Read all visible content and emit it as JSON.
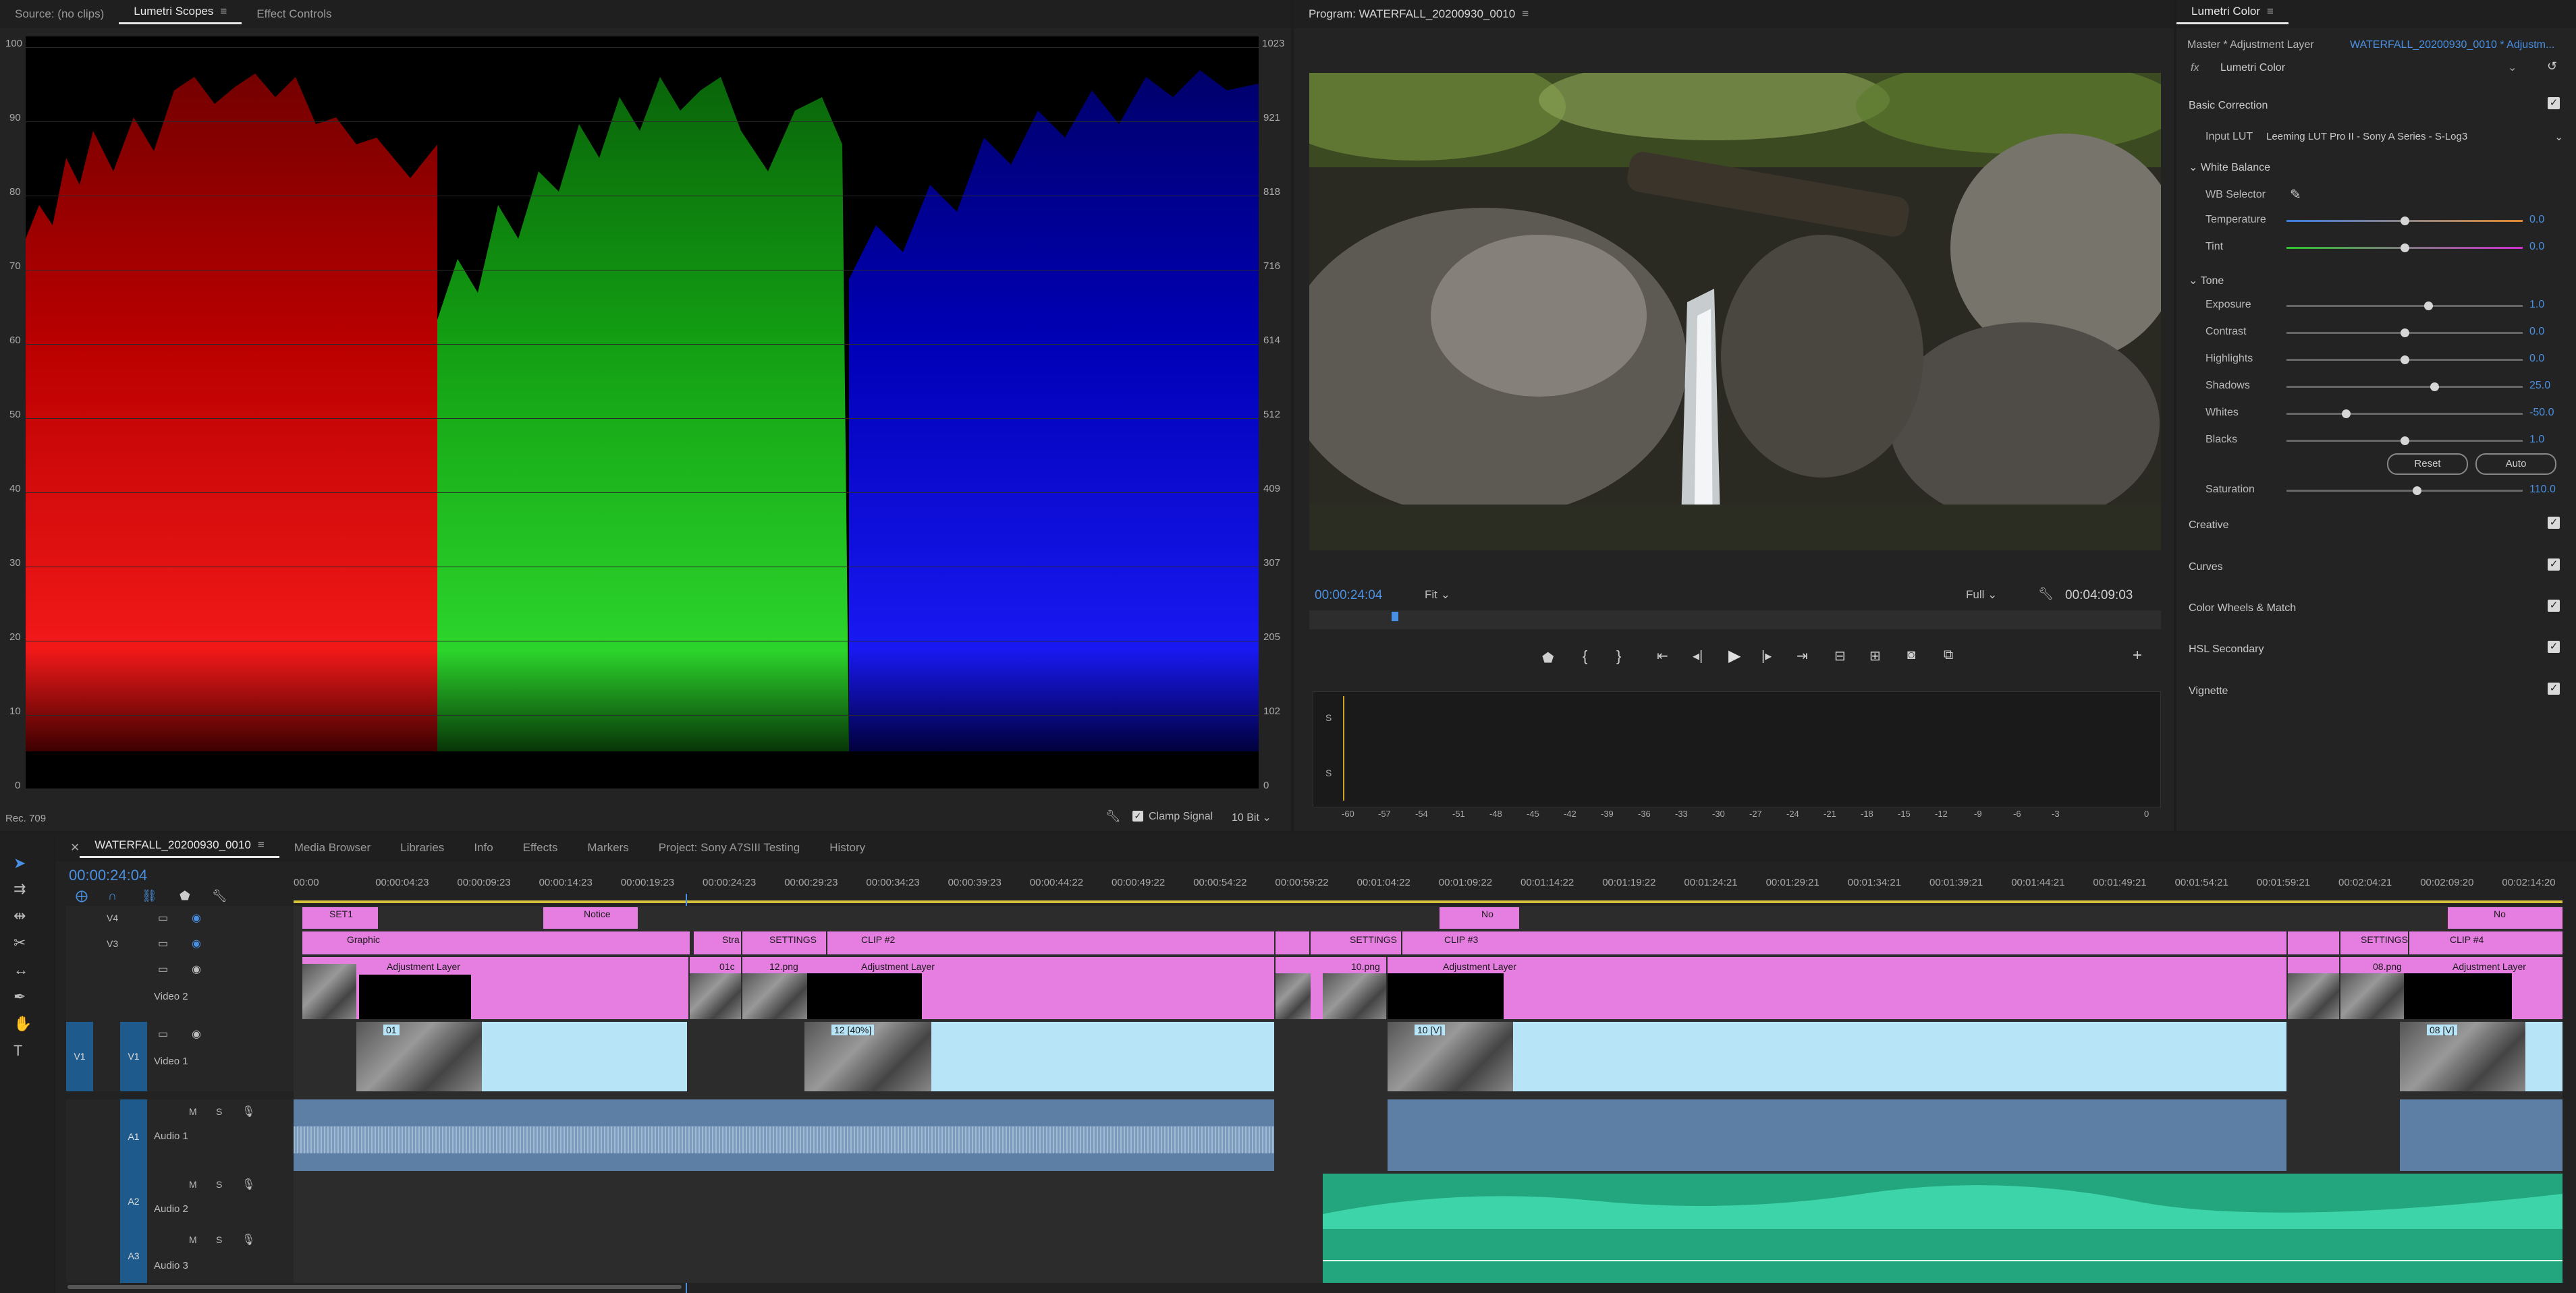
{
  "scopes_panel": {
    "tabs": [
      "Source: (no clips)",
      "Lumetri Scopes",
      "Effect Controls"
    ],
    "left_scale": [
      "100",
      "90",
      "80",
      "70",
      "60",
      "50",
      "40",
      "30",
      "20",
      "10",
      "0"
    ],
    "right_scale": [
      "1023",
      "921",
      "818",
      "716",
      "614",
      "512",
      "409",
      "307",
      "205",
      "102",
      "0"
    ],
    "color_space": "Rec. 709",
    "clamp_label": "Clamp Signal",
    "bit_depth": "10 Bit"
  },
  "program_panel": {
    "title": "Program: WATERFALL_20200930_0010",
    "timecode_current": "00:00:24:04",
    "fit": "Fit",
    "quality": "Full",
    "timecode_duration": "00:04:09:03",
    "meter_scale": [
      "-60",
      "-57",
      "-54",
      "-51",
      "-48",
      "-45",
      "-42",
      "-39",
      "-36",
      "-33",
      "-30",
      "-27",
      "-24",
      "-21",
      "-18",
      "-15",
      "-12",
      "-9",
      "-6",
      "-3",
      "0"
    ],
    "meter_s": "S"
  },
  "lumetri": {
    "title": "Lumetri Color",
    "master": "Master * Adjustment Layer",
    "sequence": "WATERFALL_20200930_0010 * Adjustm...",
    "effect": "Lumetri Color",
    "fx": "fx",
    "basic_correction": "Basic Correction",
    "input_lut_label": "Input LUT",
    "input_lut_value": "Leeming LUT Pro II - Sony A Series - S-Log3",
    "white_balance": "White Balance",
    "wb_selector": "WB Selector",
    "tone": "Tone",
    "sliders": [
      {
        "label": "Temperature",
        "value": "0.0",
        "pos": 0.5,
        "colors": "temp"
      },
      {
        "label": "Tint",
        "value": "0.0",
        "pos": 0.5,
        "colors": "tint"
      },
      {
        "label": "Exposure",
        "value": "1.0",
        "pos": 0.6
      },
      {
        "label": "Contrast",
        "value": "0.0",
        "pos": 0.5
      },
      {
        "label": "Highlights",
        "value": "0.0",
        "pos": 0.5
      },
      {
        "label": "Shadows",
        "value": "25.0",
        "pos": 0.625
      },
      {
        "label": "Whites",
        "value": "-50.0",
        "pos": 0.25
      },
      {
        "label": "Blacks",
        "value": "1.0",
        "pos": 0.5
      }
    ],
    "reset": "Reset",
    "auto": "Auto",
    "saturation_label": "Saturation",
    "saturation_value": "110.0",
    "saturation_pos": 0.55,
    "sections": [
      "Creative",
      "Curves",
      "Color Wheels & Match",
      "HSL Secondary",
      "Vignette"
    ]
  },
  "timeline": {
    "tabs": [
      "WATERFALL_20200930_0010",
      "Media Browser",
      "Libraries",
      "Info",
      "Effects",
      "Markers",
      "Project: Sony A7SIII Testing",
      "History"
    ],
    "timecode": "00:00:24:04",
    "ruler": [
      "00:00",
      "00:00:04:23",
      "00:00:09:23",
      "00:00:14:23",
      "00:00:19:23",
      "00:00:24:23",
      "00:00:29:23",
      "00:00:34:23",
      "00:00:39:23",
      "00:00:44:22",
      "00:00:49:22",
      "00:00:54:22",
      "00:00:59:22",
      "00:01:04:22",
      "00:01:09:22",
      "00:01:14:22",
      "00:01:19:22",
      "00:01:24:21",
      "00:01:29:21",
      "00:01:34:21",
      "00:01:39:21",
      "00:01:44:21",
      "00:01:49:21",
      "00:01:54:21",
      "00:01:59:21",
      "00:02:04:21",
      "00:02:09:20",
      "00:02:14:20"
    ],
    "tracks": {
      "v4": "V4",
      "v3": "V3",
      "v2": "Video 2",
      "v1": "Video 1",
      "v1_label": "V1",
      "a1": "Audio 1",
      "a2": "Audio 2",
      "a3": "Audio 3",
      "a1_label": "A1",
      "a2_label": "A2",
      "a3_label": "A3",
      "m": "M",
      "s": "S"
    },
    "clips": {
      "set1": "SET1",
      "notice": "Notice",
      "no": "No",
      "graphic": "Graphic",
      "stra": "Stra",
      "settings": "SETTINGS",
      "clip2": "CLIP #2",
      "settings2": "SETTINGS",
      "clip3": "CLIP #3",
      "settings3": "SETTINGS",
      "clip4": "CLIP #4",
      "adj": "Adjustment Layer",
      "c01": "01c",
      "png12": "12.png",
      "png10": "10.png",
      "png08": "08.png",
      "v01": "01",
      "v12": "12 [40%]",
      "v10": "10 [V]",
      "v08": "08 [V]"
    }
  }
}
